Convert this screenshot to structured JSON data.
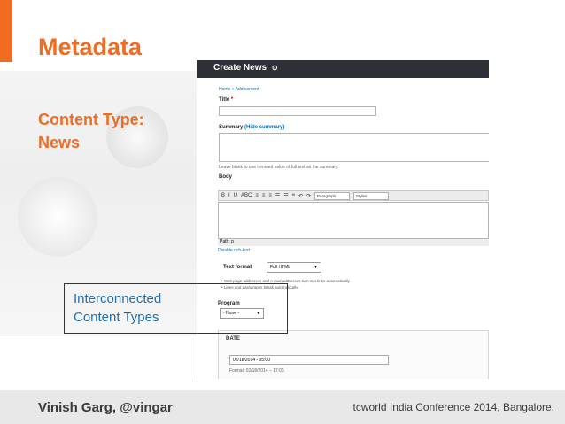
{
  "slide": {
    "title": "Metadata",
    "content_type_line1": "Content Type:",
    "content_type_line2": "News",
    "callout_line1": "Interconnected",
    "callout_line2": "Content Types"
  },
  "screenshot": {
    "header_title": "Create News",
    "header_icon": "gear-circle",
    "breadcrumb": "Home » Add content",
    "title_label": "Title",
    "title_required_mark": "*",
    "summary_label": "Summary",
    "summary_link": "(Hide summary)",
    "summary_hint": "Leave blank to use trimmed value of full text as the summary.",
    "body_label": "Body",
    "toolbar_buttons": [
      "B",
      "I",
      "U",
      "ABC",
      "≡",
      "≡",
      "≡",
      "☰",
      "☰",
      "❝",
      "↶",
      "↷"
    ],
    "toolbar_format": "Paragraph",
    "toolbar_styles": "Styles",
    "path_text": "Path: p",
    "disable_rich_text": "Disable rich-text",
    "text_format_label": "Text format",
    "text_format_value": "Full HTML",
    "format_tips": [
      "Web page addresses and e-mail addresses turn into links automatically.",
      "Lines and paragraphs break automatically."
    ],
    "program_label": "Program",
    "program_value": "- None -",
    "date_label": "DATE",
    "date_value": "02/18/2014 - 05:00",
    "date_format": "Format: 02/18/2014 – 17:06"
  },
  "footer": {
    "author": "Vinish Garg, @vingar",
    "conference": "tcworld India Conference 2014, Bangalore."
  },
  "colors": {
    "accent": "#f26b22",
    "callout_text": "#1f6fb3",
    "link": "#0074bd",
    "header_dark": "#2d3036",
    "footer_bg": "#e8e8e8"
  }
}
